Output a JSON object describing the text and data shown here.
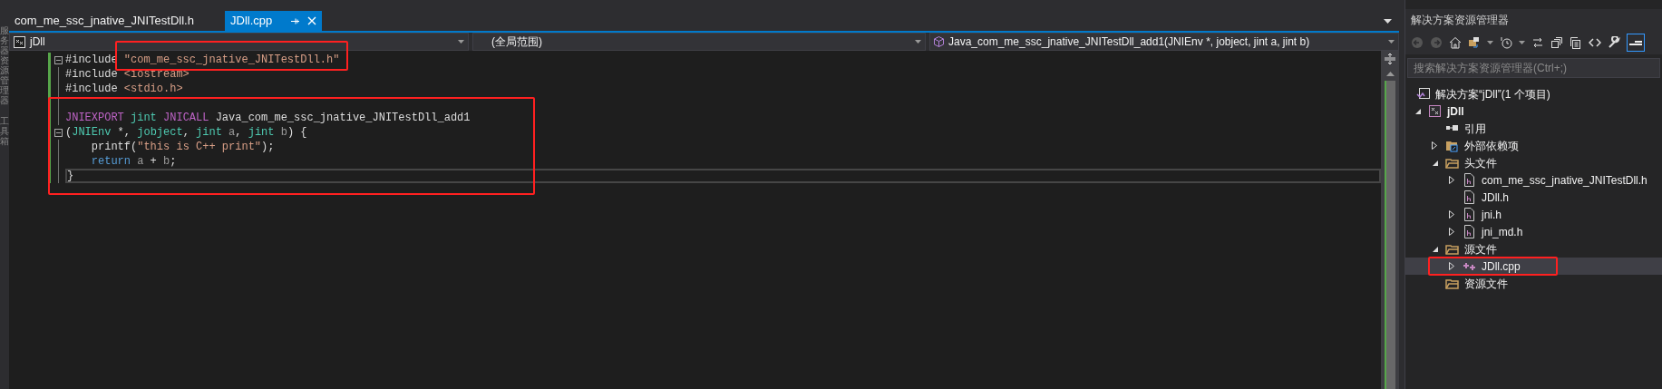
{
  "side_strip": {
    "labels": [
      "服务器资源管理器",
      "工具箱"
    ]
  },
  "tabs": [
    {
      "label": "com_me_ssc_jnative_JNITestDll.h",
      "selected": false
    },
    {
      "label": "JDll.cpp",
      "selected": true
    }
  ],
  "navigation_bar": {
    "project": "jDll",
    "scope": "(全局范围)",
    "member": "Java_com_me_ssc_jnative_JNITestDll_add1(JNIEnv *, jobject, jint a, jint b)"
  },
  "code_lines": [
    {
      "fold": true,
      "current": false,
      "tokens": [
        {
          "kind": "plain",
          "text": "#include "
        },
        {
          "kind": "string",
          "text": "\"com_me_ssc_jnative_JNITestDll.h\""
        }
      ]
    },
    {
      "fold": false,
      "current": false,
      "tokens": [
        {
          "kind": "plain",
          "text": "#include "
        },
        {
          "kind": "string",
          "text": "<iostream>"
        }
      ]
    },
    {
      "fold": false,
      "current": false,
      "tokens": [
        {
          "kind": "plain",
          "text": "#include "
        },
        {
          "kind": "string",
          "text": "<stdio.h>"
        }
      ]
    },
    {
      "fold": false
    },
    {
      "fold": false,
      "current": false,
      "tokens": [
        {
          "kind": "macro",
          "text": "JNIEXPORT "
        },
        {
          "kind": "type",
          "text": "jint "
        },
        {
          "kind": "macro",
          "text": "JNICALL"
        },
        {
          "kind": "plain",
          "text": " Java_com_me_ssc_jnative_JNITestDll_add1"
        }
      ]
    },
    {
      "fold": true,
      "current": false,
      "tokens": [
        {
          "kind": "plain",
          "text": "("
        },
        {
          "kind": "type",
          "text": "JNIEnv"
        },
        {
          "kind": "plain",
          "text": " *, "
        },
        {
          "kind": "type",
          "text": "jobject"
        },
        {
          "kind": "plain",
          "text": ", "
        },
        {
          "kind": "type",
          "text": "jint "
        },
        {
          "kind": "param",
          "text": "a"
        },
        {
          "kind": "plain",
          "text": ", "
        },
        {
          "kind": "type",
          "text": "jint "
        },
        {
          "kind": "param",
          "text": "b"
        },
        {
          "kind": "plain",
          "text": ") {"
        }
      ]
    },
    {
      "fold": false,
      "current": false,
      "tokens": [
        {
          "kind": "plain",
          "text": "    printf("
        },
        {
          "kind": "string",
          "text": "\"this is C++ print\""
        },
        {
          "kind": "plain",
          "text": ");"
        }
      ]
    },
    {
      "fold": false,
      "current": false,
      "tokens": [
        {
          "kind": "keyword",
          "text": "    return"
        },
        {
          "kind": "param",
          "text": " a"
        },
        {
          "kind": "plain",
          "text": " + "
        },
        {
          "kind": "param",
          "text": "b"
        },
        {
          "kind": "plain",
          "text": ";"
        }
      ]
    },
    {
      "fold": false,
      "current": true,
      "tokens": [
        {
          "kind": "plain",
          "text": "}"
        }
      ]
    }
  ],
  "annotations": [
    {
      "kind": "frame"
    },
    {
      "kind": "frame"
    },
    {
      "kind": "frame"
    }
  ],
  "solution_explorer": {
    "title": "解决方案资源管理器",
    "search": {
      "placeholder": "搜索解决方案资源管理器(Ctrl+;)"
    },
    "tree": [
      {
        "label": "解决方案“jDll”(1 个项目)",
        "kind": "solution",
        "selected": false,
        "children": [
          {
            "label": "jDll",
            "kind": "project",
            "selected": false,
            "expanded": true,
            "children": [
              {
                "label": "引用",
                "kind": "reference",
                "selected": false
              },
              {
                "label": "外部依赖项",
                "kind": "external",
                "selected": false,
                "expanded": false
              },
              {
                "label": "头文件",
                "kind": "folder",
                "selected": false,
                "expanded": true,
                "children": [
                  {
                    "label": "com_me_ssc_jnative_JNITestDll.h",
                    "kind": "header",
                    "selected": false,
                    "expanded": false
                  },
                  {
                    "label": "JDll.h",
                    "kind": "header",
                    "selected": false
                  },
                  {
                    "label": "jni.h",
                    "kind": "header",
                    "selected": false,
                    "expanded": false
                  },
                  {
                    "label": "jni_md.h",
                    "kind": "header",
                    "selected": false,
                    "expanded": false
                  }
                ]
              },
              {
                "label": "源文件",
                "kind": "folder",
                "selected": false,
                "expanded": true,
                "children": [
                  {
                    "label": "JDll.cpp",
                    "kind": "cpp",
                    "selected": true,
                    "expanded": false
                  }
                ]
              },
              {
                "label": "资源文件",
                "kind": "folder",
                "selected": false
              }
            ]
          }
        ]
      }
    ]
  }
}
